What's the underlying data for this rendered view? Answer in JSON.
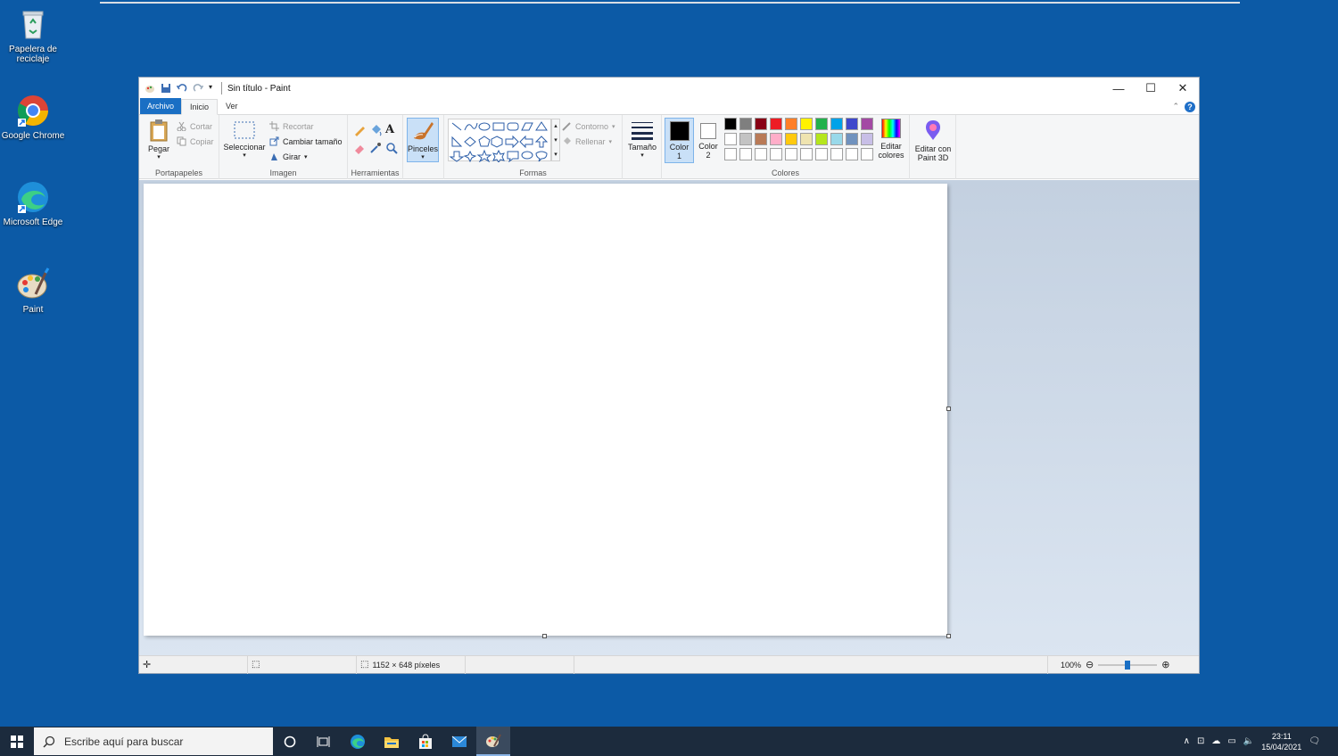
{
  "desktop": {
    "icons": [
      {
        "label": "Papelera de reciclaje"
      },
      {
        "label": "Google Chrome"
      },
      {
        "label": "Microsoft Edge"
      },
      {
        "label": "Paint"
      }
    ]
  },
  "window": {
    "title": "Sin título - Paint",
    "controls": {
      "minimize": "—",
      "maximize": "☐",
      "close": "✕"
    }
  },
  "tabs": {
    "file": "Archivo",
    "home": "Inicio",
    "view": "Ver"
  },
  "ribbon": {
    "clipboard": {
      "paste": "Pegar",
      "cut": "Cortar",
      "copy": "Copiar",
      "label": "Portapapeles"
    },
    "image": {
      "select": "Seleccionar",
      "crop": "Recortar",
      "resize": "Cambiar tamaño",
      "rotate": "Girar",
      "label": "Imagen"
    },
    "tools": {
      "label": "Herramientas"
    },
    "brushes": {
      "label": "Pinceles"
    },
    "shapes": {
      "outline": "Contorno",
      "fill": "Rellenar",
      "label": "Formas"
    },
    "size": {
      "label": "Tamaño"
    },
    "colors": {
      "color1_label": "Color",
      "color1_num": "1",
      "color2_label": "Color",
      "color2_num": "2",
      "edit_label_1": "Editar",
      "edit_label_2": "colores",
      "label": "Colores",
      "swatches": [
        "#000000",
        "#7f7f7f",
        "#880015",
        "#ed1c24",
        "#ff7f27",
        "#fff200",
        "#22b14c",
        "#00a2e8",
        "#3f48cc",
        "#a349a4",
        "#ffffff",
        "#c3c3c3",
        "#b97a57",
        "#ffaec9",
        "#ffc90e",
        "#efe4b0",
        "#b5e61d",
        "#99d9ea",
        "#7092be",
        "#c8bfe7",
        "#ffffff",
        "#ffffff",
        "#ffffff",
        "#ffffff",
        "#ffffff",
        "#ffffff",
        "#ffffff",
        "#ffffff",
        "#ffffff",
        "#ffffff"
      ]
    },
    "paint3d": {
      "line1": "Editar con",
      "line2": "Paint 3D"
    }
  },
  "status": {
    "dimensions": "1152 × 648 píxeles",
    "zoom": "100%",
    "zoom_level": 0.5
  },
  "taskbar": {
    "search_placeholder": "Escribe aquí para buscar",
    "time": "23:11",
    "date": "15/04/2021"
  }
}
